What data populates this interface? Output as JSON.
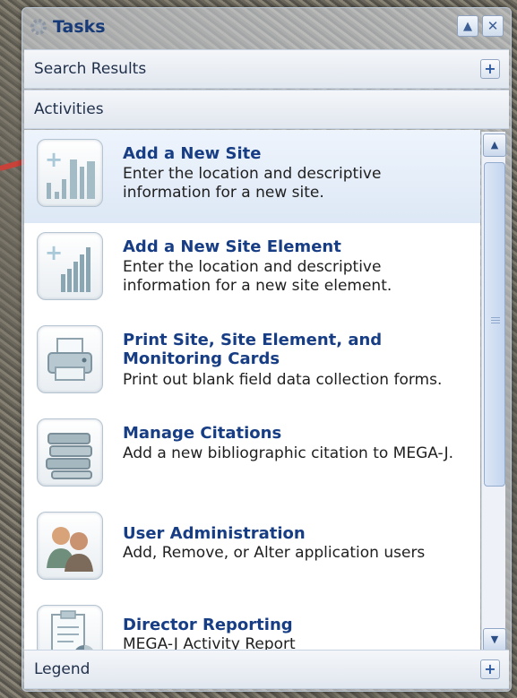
{
  "window": {
    "title": "Tasks"
  },
  "sections": {
    "search_results": "Search Results",
    "activities": "Activities",
    "legend": "Legend"
  },
  "activities": [
    {
      "title": "Add a New Site",
      "description": "Enter the location and descriptive information for a new site.",
      "icon": "add-site-icon",
      "selected": true
    },
    {
      "title": "Add a New Site Element",
      "description": "Enter the location and descriptive information for a new site element.",
      "icon": "add-site-element-icon"
    },
    {
      "title": "Print Site, Site Element, and Monitoring Cards",
      "description": "Print out blank field data collection forms.",
      "icon": "printer-icon"
    },
    {
      "title": "Manage Citations",
      "description": "Add a new bibliographic citation to MEGA-J.",
      "icon": "books-icon"
    },
    {
      "title": "User Administration",
      "description": "Add, Remove, or Alter application users",
      "icon": "users-icon"
    },
    {
      "title": "Director Reporting",
      "description": "MEGA-J Activity Report",
      "icon": "report-icon"
    }
  ],
  "colors": {
    "title": "#173b78",
    "link": "#173d84",
    "annotation_arrow": "#c8423a"
  }
}
